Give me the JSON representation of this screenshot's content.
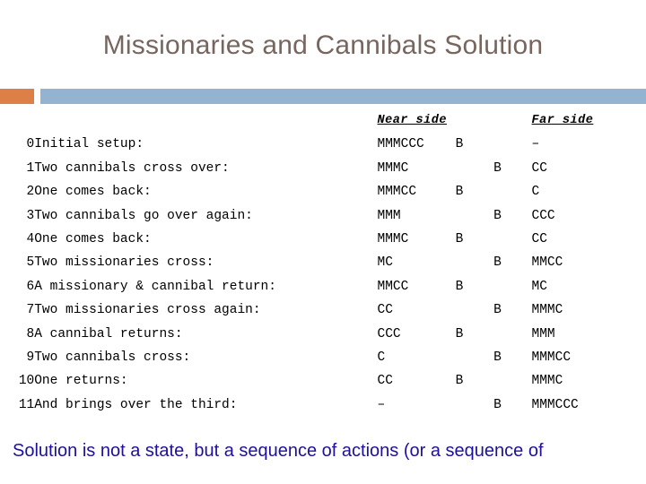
{
  "slide": {
    "title": "Missionaries and Cannibals Solution",
    "accent_orange": "#dd8047",
    "accent_blue": "#94b3d1",
    "title_color": "#77665e",
    "caption": "Solution is not a state, but a sequence of actions (or a sequence of",
    "caption_color": "#1c109c"
  },
  "table": {
    "headers": {
      "step": "",
      "description": "",
      "near_side": "Near side",
      "boat_near": "",
      "boat_far": "",
      "far_side": "Far side"
    },
    "rows": [
      {
        "step": "0",
        "description": "Initial setup:",
        "near": "MMMCCC",
        "boat_near": "B",
        "boat_far": "",
        "far": "–"
      },
      {
        "step": "1",
        "description": "Two cannibals cross over:",
        "near": "MMMC",
        "boat_near": "",
        "boat_far": "B",
        "far": "CC"
      },
      {
        "step": "2",
        "description": "One comes back:",
        "near": "MMMCC",
        "boat_near": "B",
        "boat_far": "",
        "far": "C"
      },
      {
        "step": "3",
        "description": "Two cannibals go over again:",
        "near": "MMM",
        "boat_near": "",
        "boat_far": "B",
        "far": "CCC"
      },
      {
        "step": "4",
        "description": "One comes back:",
        "near": "MMMC",
        "boat_near": "B",
        "boat_far": "",
        "far": "CC"
      },
      {
        "step": "5",
        "description": "Two missionaries cross:",
        "near": "MC",
        "boat_near": "",
        "boat_far": "B",
        "far": "MMCC"
      },
      {
        "step": "6",
        "description": "A missionary & cannibal return:",
        "near": "MMCC",
        "boat_near": "B",
        "boat_far": "",
        "far": "MC"
      },
      {
        "step": "7",
        "description": "Two missionaries cross again:",
        "near": "CC",
        "boat_near": "",
        "boat_far": "B",
        "far": "MMMC"
      },
      {
        "step": "8",
        "description": "A cannibal returns:",
        "near": "CCC",
        "boat_near": "B",
        "boat_far": "",
        "far": "MMM"
      },
      {
        "step": "9",
        "description": "Two cannibals cross:",
        "near": "C",
        "boat_near": "",
        "boat_far": "B",
        "far": "MMMCC"
      },
      {
        "step": "10",
        "description": "One returns:",
        "near": "CC",
        "boat_near": "B",
        "boat_far": "",
        "far": "MMMC"
      },
      {
        "step": "11",
        "description": "And brings over the third:",
        "near": "–",
        "boat_near": "",
        "boat_far": "B",
        "far": "MMMCCC"
      }
    ]
  }
}
